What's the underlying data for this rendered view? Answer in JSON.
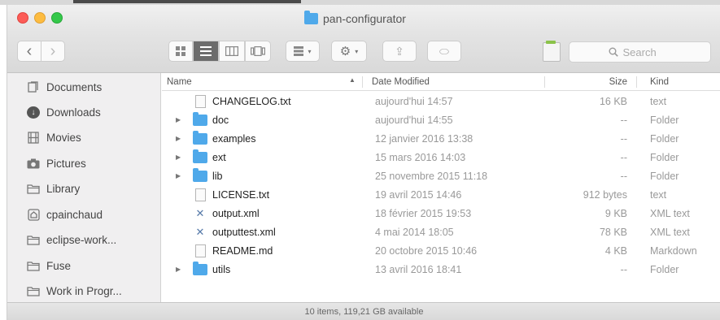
{
  "window": {
    "title": "pan-configurator"
  },
  "toolbar": {
    "back": "‹",
    "forward": "›",
    "share": "⇪",
    "tag": "⬭",
    "search_placeholder": "Search"
  },
  "sidebar": {
    "items": [
      {
        "label": "Documents",
        "icon": "documents-icon"
      },
      {
        "label": "Downloads",
        "icon": "downloads-icon"
      },
      {
        "label": "Movies",
        "icon": "movies-icon"
      },
      {
        "label": "Pictures",
        "icon": "pictures-icon"
      },
      {
        "label": "Library",
        "icon": "folder-icon"
      },
      {
        "label": "cpainchaud",
        "icon": "home-icon"
      },
      {
        "label": "eclipse-work...",
        "icon": "folder-icon"
      },
      {
        "label": "Fuse",
        "icon": "folder-icon"
      },
      {
        "label": "Work in Progr...",
        "icon": "folder-icon"
      }
    ]
  },
  "columns": {
    "name": "Name",
    "date": "Date Modified",
    "size": "Size",
    "kind": "Kind"
  },
  "files": [
    {
      "name": "CHANGELOG.txt",
      "date": "aujourd'hui 14:57",
      "size": "16 KB",
      "kind": "text",
      "type": "doc"
    },
    {
      "name": "doc",
      "date": "aujourd'hui 14:55",
      "size": "--",
      "kind": "Folder",
      "type": "folder"
    },
    {
      "name": "examples",
      "date": "12 janvier 2016 13:38",
      "size": "--",
      "kind": "Folder",
      "type": "folder"
    },
    {
      "name": "ext",
      "date": "15 mars 2016 14:03",
      "size": "--",
      "kind": "Folder",
      "type": "folder"
    },
    {
      "name": "lib",
      "date": "25 novembre 2015 11:18",
      "size": "--",
      "kind": "Folder",
      "type": "folder"
    },
    {
      "name": "LICENSE.txt",
      "date": "19 avril 2015 14:46",
      "size": "912 bytes",
      "kind": "text",
      "type": "doc"
    },
    {
      "name": "output.xml",
      "date": "18 février 2015 19:53",
      "size": "9 KB",
      "kind": "XML text",
      "type": "xml"
    },
    {
      "name": "outputtest.xml",
      "date": "4 mai 2014 18:05",
      "size": "78 KB",
      "kind": "XML text",
      "type": "xml"
    },
    {
      "name": "README.md",
      "date": "20 octobre 2015 10:46",
      "size": "4 KB",
      "kind": "Markdown",
      "type": "doc"
    },
    {
      "name": "utils",
      "date": "13 avril 2016 18:41",
      "size": "--",
      "kind": "Folder",
      "type": "folder"
    }
  ],
  "status": {
    "text": "10 items, 119,21 GB available"
  },
  "colors": {
    "folder": "#4fa9ea",
    "close": "#fc5c57",
    "minimize": "#fdbc40",
    "maximize": "#34c84a"
  }
}
